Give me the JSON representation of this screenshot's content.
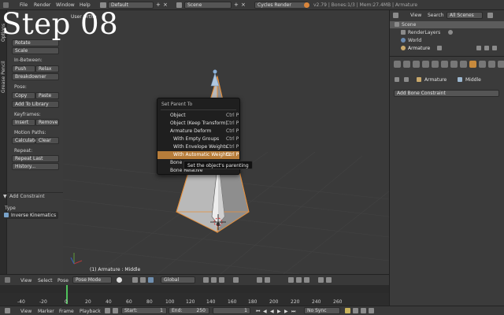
{
  "overlay_title": "Step 08",
  "top_menu": {
    "items": [
      "File",
      "Render",
      "Window",
      "Help"
    ],
    "screen_layout": "Default",
    "scene": "Scene",
    "render_engine": "Cycles Render",
    "info": "v2.79 | Bones:1/3 | Mem:27.4MB | Armature"
  },
  "tool_shelf": {
    "tabs": [
      "Options",
      "Grease Pencil"
    ],
    "buttons_top": [
      "Rotate",
      "Scale"
    ],
    "in_between_label": "In-Between:",
    "push": "Push",
    "relax": "Relax",
    "breakdowner": "Breakdowner",
    "pose_label": "Pose:",
    "copy": "Copy",
    "paste": "Paste",
    "add_to_library": "Add To Library",
    "keyframes_label": "Keyframes:",
    "insert": "Insert",
    "remove": "Remove",
    "motion_paths_label": "Motion Paths:",
    "calculate": "Calculate",
    "clear": "Clear",
    "repeat_label": "Repeat:",
    "repeat_last": "Repeat Last",
    "history": "History...",
    "add_constraint": "Add Constraint",
    "type_label": "Type",
    "type_value": "Inverse Kinematics"
  },
  "viewport": {
    "label": "User Ortho",
    "status": "(1) Armature : Middle"
  },
  "parent_menu": {
    "title": "Set Parent To",
    "items": [
      {
        "label": "Object",
        "shortcut": "Ctrl P"
      },
      {
        "label": "Object (Keep Transform)",
        "shortcut": "Ctrl P"
      },
      {
        "label": "Armature Deform",
        "shortcut": "Ctrl P"
      },
      {
        "label": "With Empty Groups",
        "shortcut": "Ctrl P"
      },
      {
        "label": "With Envelope Weights",
        "shortcut": "Ctrl P"
      },
      {
        "label": "With Automatic Weights",
        "shortcut": "Ctrl P"
      },
      {
        "label": "Bone",
        "shortcut": ""
      },
      {
        "label": "Bone Relative",
        "shortcut": ""
      }
    ],
    "highlighted": "With Automatic Weights",
    "tooltip": "Set the object's parenting"
  },
  "view_header": {
    "view": "View",
    "select": "Select",
    "pose": "Pose",
    "mode": "Pose Mode",
    "pivot": "Global"
  },
  "timeline": {
    "ticks": [
      "-40",
      "-20",
      "0",
      "20",
      "40",
      "60",
      "80",
      "100",
      "120",
      "140",
      "160",
      "180",
      "200",
      "220",
      "240",
      "260"
    ],
    "current_frame": "1"
  },
  "bottom_bar": {
    "view": "View",
    "marker": "Marker",
    "frame": "Frame",
    "playback": "Playback",
    "start_label": "Start:",
    "start_value": "1",
    "end_label": "End:",
    "end_value": "250",
    "current": "1",
    "sync": "No Sync"
  },
  "outliner": {
    "view": "View",
    "search": "Search",
    "filter": "All Scenes",
    "rows": [
      "Scene",
      "RenderLayers",
      "World",
      "Armature"
    ],
    "selected": "Armature"
  },
  "properties": {
    "armature_label": "Armature",
    "bone_label": "Middle",
    "add_bone_constraint": "Add Bone Constraint"
  },
  "colors": {
    "highlight": "#b77d3a",
    "selected_outline": "#e8903a",
    "playhead": "#4fc35b",
    "background": "#3a3a3a"
  }
}
